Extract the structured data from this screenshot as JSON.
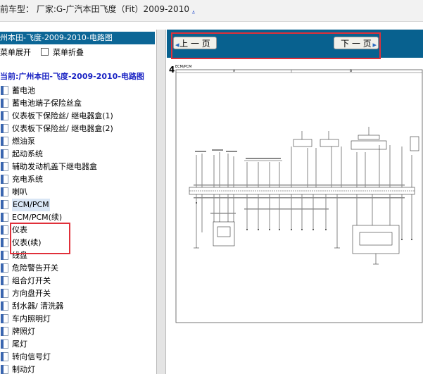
{
  "header": {
    "title": "前车型： 厂家:G-广汽本田飞度（Fit）2009-2010",
    "link": "."
  },
  "sidebar": {
    "title": "州本田-飞度-2009-2010-电路图",
    "expand_all": "菜单展开",
    "collapse_all": "菜单折叠",
    "current": "当前:广州本田-飞度-2009-2010-电路图",
    "items": [
      {
        "label": "蓄电池"
      },
      {
        "label": "蓄电池端子保险丝盒"
      },
      {
        "label": "仪表板下保险丝/ 继电器盒(1)"
      },
      {
        "label": "仪表板下保险丝/ 继电器盒(2)"
      },
      {
        "label": "燃油泵"
      },
      {
        "label": "起动系统"
      },
      {
        "label": "辅助发动机盖下继电器盒"
      },
      {
        "label": "充电系统"
      },
      {
        "label": "喇叭"
      },
      {
        "label": "ECM/PCM",
        "selected": true
      },
      {
        "label": "ECM/PCM(续)"
      },
      {
        "label": "仪表"
      },
      {
        "label": "仪表(续)"
      },
      {
        "label": "线盘"
      },
      {
        "label": "危险警告开关"
      },
      {
        "label": "组合灯开关"
      },
      {
        "label": "方向盘开关"
      },
      {
        "label": "刮水器/ 清洗器"
      },
      {
        "label": "车内照明灯"
      },
      {
        "label": "牌照灯"
      },
      {
        "label": "尾灯"
      },
      {
        "label": "转向信号灯"
      },
      {
        "label": "制动灯"
      }
    ]
  },
  "content": {
    "prev_label": "上 一 页",
    "next_label": "下 一 页",
    "page_number": "4",
    "diagram_title": "ECM/PCM",
    "col_a": "A",
    "col_b": "B"
  }
}
